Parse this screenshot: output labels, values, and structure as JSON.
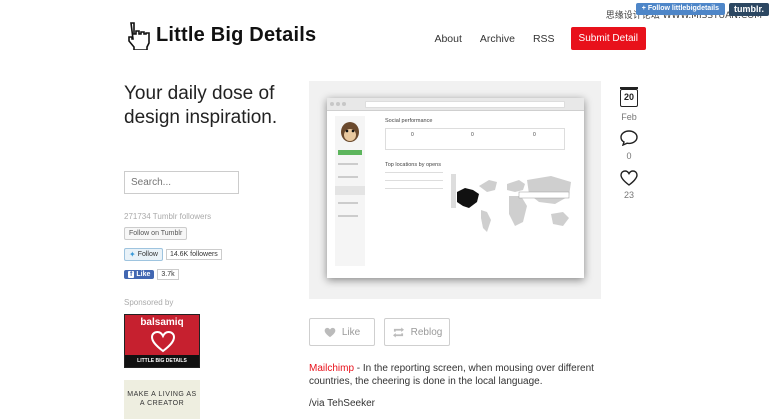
{
  "overlay": {
    "watermark": "思缘设计论坛 WWW.MISSYUAN.COM",
    "follow_label": "+ Follow littlebigdetails",
    "tumblr_label": "tumblr."
  },
  "header": {
    "site_title": "Little Big Details",
    "nav": [
      {
        "label": "About"
      },
      {
        "label": "Archive"
      },
      {
        "label": "RSS"
      }
    ],
    "submit_label": "Submit Detail"
  },
  "sidebar": {
    "tagline": "Your daily dose of design inspiration.",
    "search_placeholder": "Search...",
    "followers_text": "271734 Tumblr followers",
    "follow_tumblr_label": "Follow on Tumblr",
    "twitter_follow_label": "Follow",
    "twitter_count": "14.6K followers",
    "fb_like_label": "Like",
    "fb_count": "3.7k",
    "sponsored_label": "Sponsored by",
    "ad1_brand": "balsamiq",
    "ad1_strip": "LITTLE BIG DETAILS",
    "ad2_text": "MAKE A LIVING AS A CREATOR"
  },
  "post": {
    "date_day": "20",
    "date_month": "Feb",
    "comment_count": "0",
    "like_count": "23",
    "like_label": "Like",
    "reblog_label": "Reblog",
    "caption_link": "Mailchimp",
    "caption_text": " - In the reporting screen, when mousing over different countries, the cheering is done in the local language.",
    "via": "/via TehSeeker"
  },
  "screenshot": {
    "section1": "Social performance",
    "stat_value": "0",
    "section2": "Top locations by opens",
    "nav_items": [
      "Dashboard",
      "Campaigns",
      "Lists",
      "Reports",
      "Autoresponders",
      "Search"
    ]
  },
  "colors": {
    "accent_red": "#e8111b",
    "tumblr_blue": "#4e86c8",
    "facebook_blue": "#4267b2",
    "balsamiq_red": "#c6202f"
  }
}
